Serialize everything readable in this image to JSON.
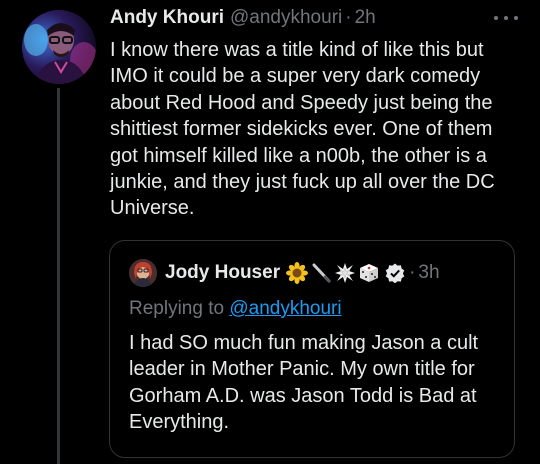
{
  "tweet": {
    "author_name": "Andy Khouri",
    "author_handle": "@andykhouri",
    "separator": "·",
    "time": "2h",
    "avatar_icon": "user-avatar-icon",
    "more_icon": "more-options-icon",
    "text": "I know there was a title kind of like this but IMO it could be a super very dark comedy about Red Hood and Speedy just being the shittiest former sidekicks ever. One of them got himself killed like a n00b, the other is a junkie, and they just fuck up all over the DC Universe."
  },
  "quote": {
    "author_name": "Jody Houser",
    "emojis": [
      "sunflower-icon",
      "pencil-icon",
      "collision-icon",
      "die-icon"
    ],
    "verified_icon": "verified-badge-icon",
    "separator": "·",
    "time": "3h",
    "replying_prefix": "Replying to",
    "replying_handle": "@andykhouri",
    "text": "I had SO much fun making Jason a cult leader in Mother Panic. My own title for Gorham A.D. was Jason Todd is Bad at Everything."
  },
  "colors": {
    "background": "#000000",
    "text_primary": "#e7e9ea",
    "text_secondary": "#71767b",
    "link": "#1d9bf0",
    "border": "#2f3336"
  }
}
